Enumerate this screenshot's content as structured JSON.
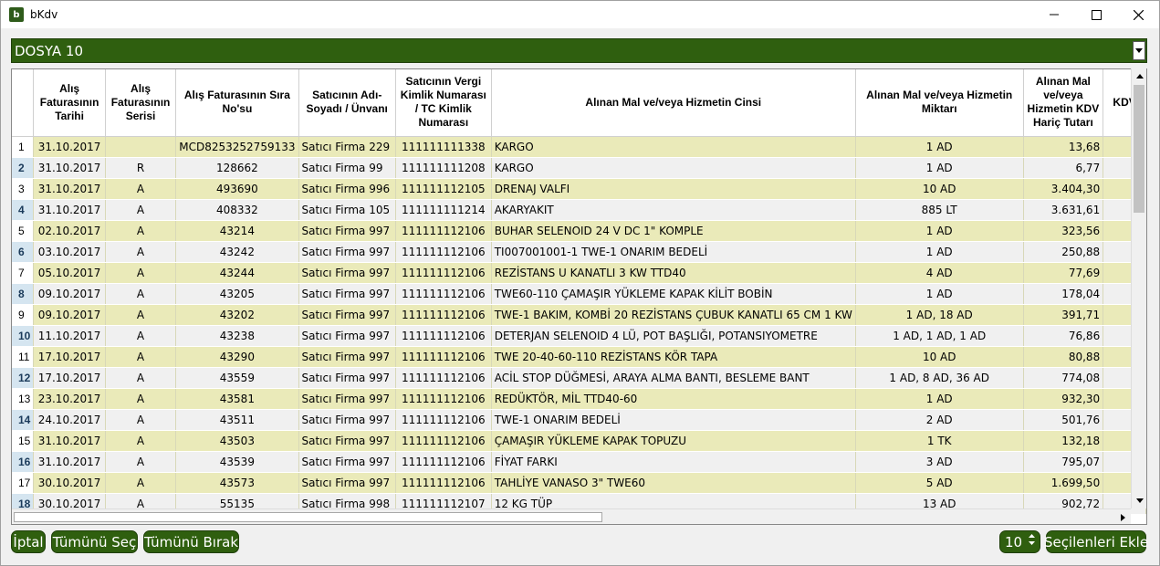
{
  "window": {
    "title": "bKdv",
    "icon": "app-logo-icon"
  },
  "dosya": {
    "selected": "DOSYA 10"
  },
  "table": {
    "columns": [
      {
        "label": ""
      },
      {
        "label": "Alış Faturasının Tarihi"
      },
      {
        "label": "Alış Faturasının Serisi"
      },
      {
        "label": "Alış Faturasının Sıra No'su"
      },
      {
        "label": "Satıcının Adı-Soyadı / Ünvanı"
      },
      {
        "label": "Satıcının Vergi Kimlik Numarası / TC Kimlik Numarası"
      },
      {
        "label": "Alınan Mal ve/veya Hizmetin Cinsi"
      },
      {
        "label": "Alınan Mal ve/veya Hizmetin Miktarı"
      },
      {
        "label": "Alınan Mal ve/veya Hizmetin KDV Hariç Tutarı"
      },
      {
        "label": "KDV"
      }
    ],
    "rows": [
      [
        "1",
        "31.10.2017",
        "",
        "MCD8253252759133",
        "Satıcı Firma 229",
        "111111111338",
        "KARGO",
        "1 AD",
        "13,68",
        ""
      ],
      [
        "2",
        "31.10.2017",
        "R",
        "128662",
        "Satıcı Firma 99",
        "111111111208",
        "KARGO",
        "1 AD",
        "6,77",
        ""
      ],
      [
        "3",
        "31.10.2017",
        "A",
        "493690",
        "Satıcı Firma 996",
        "111111112105",
        "DRENAJ VALFI",
        "10 AD",
        "3.404,30",
        ""
      ],
      [
        "4",
        "31.10.2017",
        "A",
        "408332",
        "Satıcı Firma 105",
        "111111111214",
        "AKARYAKIT",
        "885 LT",
        "3.631,61",
        ""
      ],
      [
        "5",
        "02.10.2017",
        "A",
        "43214",
        "Satıcı Firma 997",
        "111111112106",
        "BUHAR SELENOID 24 V DC 1\" KOMPLE",
        "1 AD",
        "323,56",
        ""
      ],
      [
        "6",
        "03.10.2017",
        "A",
        "43242",
        "Satıcı Firma 997",
        "111111112106",
        "TI007001001-1 TWE-1 ONARIM BEDELİ",
        "1 AD",
        "250,88",
        ""
      ],
      [
        "7",
        "05.10.2017",
        "A",
        "43244",
        "Satıcı Firma 997",
        "111111112106",
        "REZİSTANS U KANATLI 3 KW TTD40",
        "4 AD",
        "77,69",
        ""
      ],
      [
        "8",
        "09.10.2017",
        "A",
        "43205",
        "Satıcı Firma 997",
        "111111112106",
        "TWE60-110 ÇAMAŞIR YÜKLEME KAPAK KİLİT BOBİN",
        "1 AD",
        "178,04",
        ""
      ],
      [
        "9",
        "09.10.2017",
        "A",
        "43202",
        "Satıcı Firma 997",
        "111111112106",
        "TWE-1 BAKIM, KOMBİ 20 REZİSTANS ÇUBUK KANATLI 65 CM 1 KW",
        "1 AD, 18 AD",
        "391,71",
        ""
      ],
      [
        "10",
        "11.10.2017",
        "A",
        "43238",
        "Satıcı Firma 997",
        "111111112106",
        "DETERJAN SELENOID 4 LÜ, POT BAŞLIĞI, POTANSIYOMETRE",
        "1 AD, 1 AD, 1 AD",
        "76,86",
        ""
      ],
      [
        "11",
        "17.10.2017",
        "A",
        "43290",
        "Satıcı Firma 997",
        "111111112106",
        "TWE 20-40-60-110 REZİSTANS KÖR TAPA",
        "10 AD",
        "80,88",
        ""
      ],
      [
        "12",
        "17.10.2017",
        "A",
        "43559",
        "Satıcı Firma 997",
        "111111112106",
        "ACİL STOP DÜĞMESİ, ARAYA ALMA BANTI, BESLEME BANT",
        "1 AD, 8 AD, 36 AD",
        "774,08",
        ""
      ],
      [
        "13",
        "23.10.2017",
        "A",
        "43581",
        "Satıcı Firma 997",
        "111111112106",
        "REDÜKTÖR, MİL TTD40-60",
        "1 AD",
        "932,30",
        ""
      ],
      [
        "14",
        "24.10.2017",
        "A",
        "43511",
        "Satıcı Firma 997",
        "111111112106",
        "TWE-1 ONARIM BEDELİ",
        "2 AD",
        "501,76",
        ""
      ],
      [
        "15",
        "31.10.2017",
        "A",
        "43503",
        "Satıcı Firma 997",
        "111111112106",
        "ÇAMAŞIR YÜKLEME KAPAK TOPUZU",
        "1 TK",
        "132,18",
        ""
      ],
      [
        "16",
        "31.10.2017",
        "A",
        "43539",
        "Satıcı Firma 997",
        "111111112106",
        "FİYAT FARKI",
        "3 AD",
        "795,07",
        ""
      ],
      [
        "17",
        "30.10.2017",
        "A",
        "43573",
        "Satıcı Firma 997",
        "111111112106",
        "TAHLİYE VANASO 3\" TWE60",
        "5 AD",
        "1.699,50",
        ""
      ],
      [
        "18",
        "30.10.2017",
        "A",
        "55135",
        "Satıcı Firma 998",
        "111111112107",
        "12 KG TÜP",
        "13 AD",
        "902,72",
        ""
      ]
    ]
  },
  "footer": {
    "cancel_label": "İptal",
    "select_all_label": "Tümünü Seç",
    "deselect_all_label": "Tümünü Bırak",
    "count_value": "10",
    "add_selected_label": "Seçilenleri Ekle"
  },
  "colors": {
    "accent": "#2f5f0f",
    "row_odd": "#eaeab9",
    "row_even": "#f0f0f0"
  }
}
